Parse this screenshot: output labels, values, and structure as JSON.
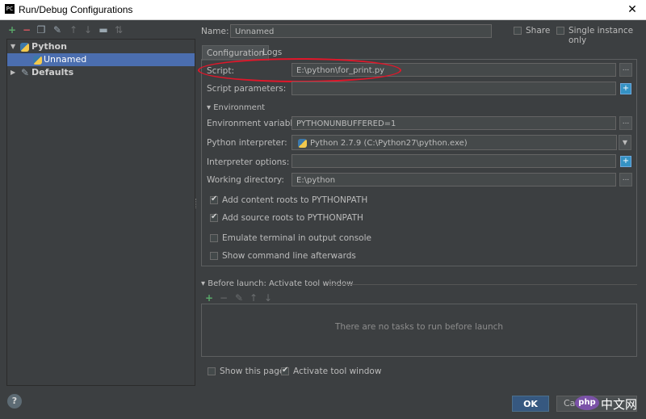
{
  "window": {
    "app_icon_text": "PC",
    "title": "Run/Debug Configurations",
    "close_glyph": "✕"
  },
  "toolbar": {
    "icons": [
      "add-icon",
      "remove-icon",
      "copy-icon",
      "wrench-icon",
      "move-up-icon",
      "move-down-icon",
      "folder-icon",
      "sort-icon"
    ],
    "glyphs": {
      "add": "+",
      "remove": "−",
      "copy": "❐",
      "wrench": "✎",
      "up": "↑",
      "down": "↓",
      "folder": "▬",
      "sort": "⇅"
    }
  },
  "tree": {
    "python_label": "Python",
    "unnamed_label": "Unnamed",
    "defaults_label": "Defaults",
    "expand_open": "▼",
    "expand_closed": "▶"
  },
  "header": {
    "name_label": "Name:",
    "name_value": "Unnamed",
    "share_label": "Share",
    "single_instance_label": "Single instance only"
  },
  "tabs": [
    {
      "label": "Configuration"
    },
    {
      "label": "Logs"
    }
  ],
  "config": {
    "script_label": "Script:",
    "script_value": "E:\\python\\for_print.py",
    "script_params_label": "Script parameters:",
    "script_params_value": "",
    "environment_label": "Environment",
    "env_vars_label": "Environment variables:",
    "env_vars_value": "PYTHONUNBUFFERED=1",
    "interpreter_label": "Python interpreter:",
    "interpreter_value": "Python 2.7.9 (C:\\Python27\\python.exe)",
    "interp_options_label": "Interpreter options:",
    "interp_options_value": "",
    "working_dir_label": "Working directory:",
    "working_dir_value": "E:\\python",
    "add_content_roots_label": "Add content roots to PYTHONPATH",
    "add_source_roots_label": "Add source roots to PYTHONPATH",
    "emulate_terminal_label": "Emulate terminal in output console",
    "show_command_line_label": "Show command line afterwards",
    "dots_glyph": "...",
    "plus_glyph": "+",
    "dropdown_glyph": "▼",
    "collapse_glyph": "▾"
  },
  "before_launch": {
    "title": "Before launch: Activate tool window",
    "empty_text": "There are no tasks to run before launch",
    "glyphs": {
      "add": "+",
      "remove": "−",
      "edit": "✎",
      "up": "↑",
      "down": "↓"
    },
    "show_page_label": "Show this page",
    "activate_window_label": "Activate tool window"
  },
  "footer": {
    "help_glyph": "?",
    "ok_label": "OK",
    "cancel_label": "Ca"
  },
  "watermark": {
    "logo_text": "php",
    "site_text": "中文网"
  },
  "colors": {
    "background": "#3c3f41",
    "selection": "#4b6eaf",
    "annotation_ellipse": "#e0172a",
    "ok_button": "#365880"
  }
}
